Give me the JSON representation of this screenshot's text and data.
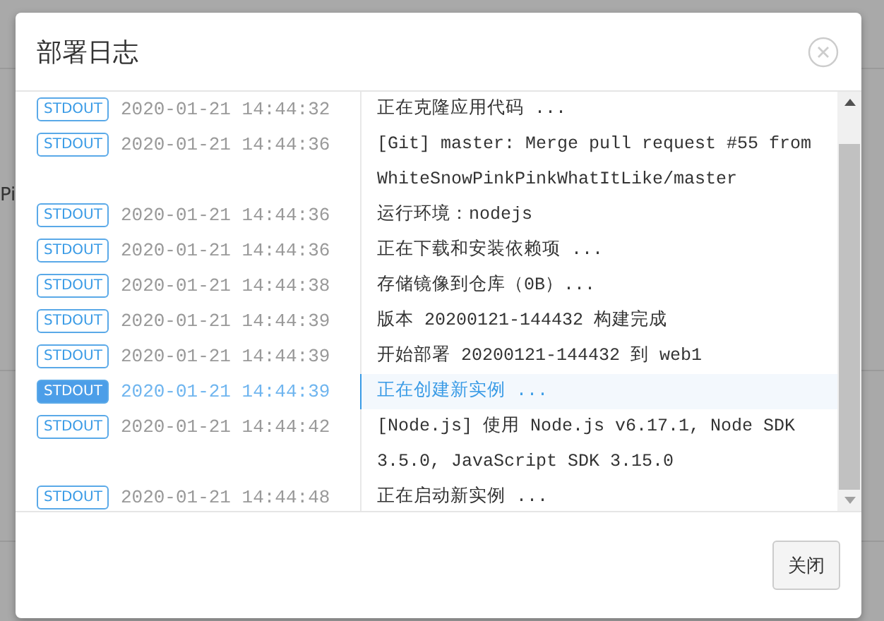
{
  "background": {
    "text": "Pi"
  },
  "dialog": {
    "title": "部署日志",
    "close_button": {
      "label": "关闭"
    }
  },
  "log": [
    {
      "stream": "STDOUT",
      "time": "2020-01-21 14:44:32",
      "message": "正在克隆应用代码 ...",
      "selected": false
    },
    {
      "stream": "STDOUT",
      "time": "2020-01-21 14:44:36",
      "message": "[Git] master: Merge pull request #55 from WhiteSnowPinkPinkWhatItLike/master",
      "selected": false
    },
    {
      "stream": "STDOUT",
      "time": "2020-01-21 14:44:36",
      "message": "运行环境：nodejs",
      "selected": false
    },
    {
      "stream": "STDOUT",
      "time": "2020-01-21 14:44:36",
      "message": "正在下载和安装依赖项 ...",
      "selected": false
    },
    {
      "stream": "STDOUT",
      "time": "2020-01-21 14:44:38",
      "message": "存储镜像到仓库（0B）...",
      "selected": false
    },
    {
      "stream": "STDOUT",
      "time": "2020-01-21 14:44:39",
      "message": "版本 20200121-144432 构建完成",
      "selected": false
    },
    {
      "stream": "STDOUT",
      "time": "2020-01-21 14:44:39",
      "message": "开始部署 20200121-144432 到 web1",
      "selected": false
    },
    {
      "stream": "STDOUT",
      "time": "2020-01-21 14:44:39",
      "message": "正在创建新实例 ...",
      "selected": true
    },
    {
      "stream": "STDOUT",
      "time": "2020-01-21 14:44:42",
      "message": "[Node.js] 使用 Node.js v6.17.1, Node SDK 3.5.0, JavaScript SDK 3.15.0",
      "selected": false
    },
    {
      "stream": "STDOUT",
      "time": "2020-01-21 14:44:48",
      "message": "正在启动新实例 ...",
      "selected": false
    }
  ]
}
